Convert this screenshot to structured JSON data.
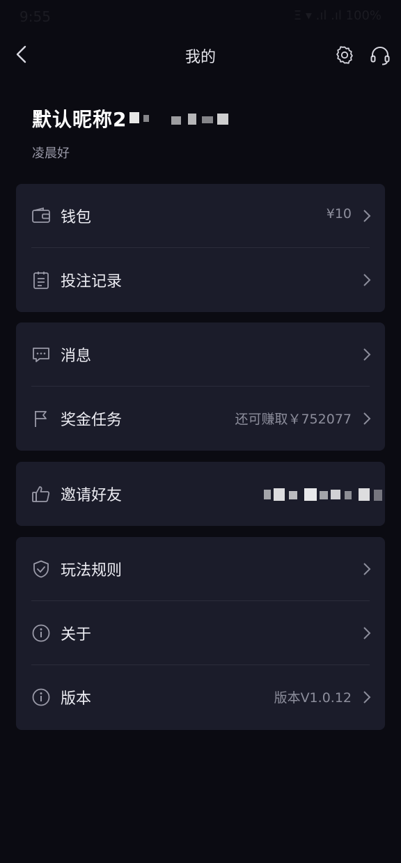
{
  "status_bar": {
    "time": "9:55",
    "right": "Ξ ▾ .ıl .ıl 100%"
  },
  "nav": {
    "title": "我的"
  },
  "profile": {
    "nickname": "默认昵称2",
    "greeting": "凌晨好"
  },
  "menu": {
    "wallet": {
      "label": "钱包",
      "value": "¥10"
    },
    "bet_records": {
      "label": "投注记录"
    },
    "messages": {
      "label": "消息"
    },
    "bonus_tasks": {
      "label": "奖金任务",
      "value": "还可赚取￥752077"
    },
    "invite": {
      "label": "邀请好友"
    },
    "rules": {
      "label": "玩法规则"
    },
    "about": {
      "label": "关于"
    },
    "version": {
      "label": "版本",
      "value": "版本V1.0.12"
    }
  },
  "colors": {
    "background": "#0b0b12",
    "card": "#1b1c2a",
    "text": "#ececf2",
    "muted": "#8d8e9c"
  }
}
